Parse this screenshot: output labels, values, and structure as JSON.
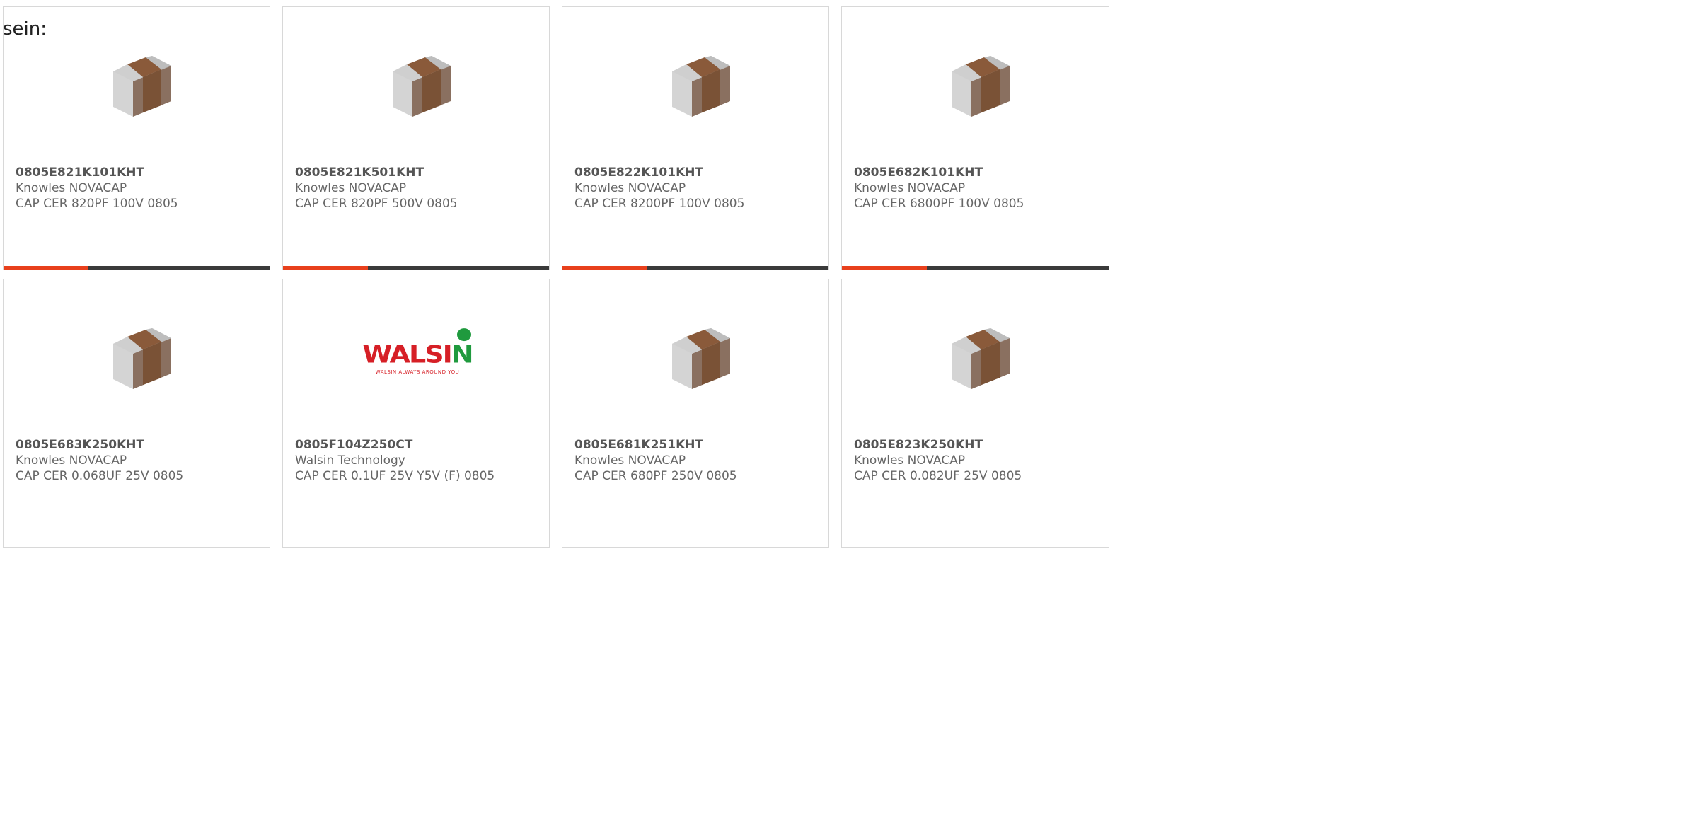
{
  "intro_text": "sein:",
  "accent_color": "#e8401c",
  "bar_color": "#3a3a3a",
  "products": [
    {
      "part_number": "0805E821K101KHT",
      "manufacturer": "Knowles NOVACAP",
      "description": "CAP CER 820PF 100V 0805",
      "image": "ceramic-capacitor-chip"
    },
    {
      "part_number": "0805E821K501KHT",
      "manufacturer": "Knowles NOVACAP",
      "description": "CAP CER 820PF 500V 0805",
      "image": "ceramic-capacitor-chip"
    },
    {
      "part_number": "0805E822K101KHT",
      "manufacturer": "Knowles NOVACAP",
      "description": "CAP CER 8200PF 100V 0805",
      "image": "ceramic-capacitor-chip"
    },
    {
      "part_number": "0805E682K101KHT",
      "manufacturer": "Knowles NOVACAP",
      "description": "CAP CER 6800PF 100V 0805",
      "image": "ceramic-capacitor-chip"
    },
    {
      "part_number": "0805E683K250KHT",
      "manufacturer": "Knowles NOVACAP",
      "description": "CAP CER 0.068UF 25V 0805",
      "image": "ceramic-capacitor-chip"
    },
    {
      "part_number": "0805F104Z250CT",
      "manufacturer": "Walsin Technology",
      "description": "CAP CER 0.1UF 25V Y5V (F) 0805",
      "image": "walsin-logo",
      "logo_word_red": "WALSI",
      "logo_word_green": "N",
      "logo_tagline": "WALSIN ALWAYS AROUND YOU"
    },
    {
      "part_number": "0805E681K251KHT",
      "manufacturer": "Knowles NOVACAP",
      "description": "CAP CER 680PF 250V 0805",
      "image": "ceramic-capacitor-chip"
    },
    {
      "part_number": "0805E823K250KHT",
      "manufacturer": "Knowles NOVACAP",
      "description": "CAP CER 0.082UF 25V 0805",
      "image": "ceramic-capacitor-chip"
    }
  ]
}
